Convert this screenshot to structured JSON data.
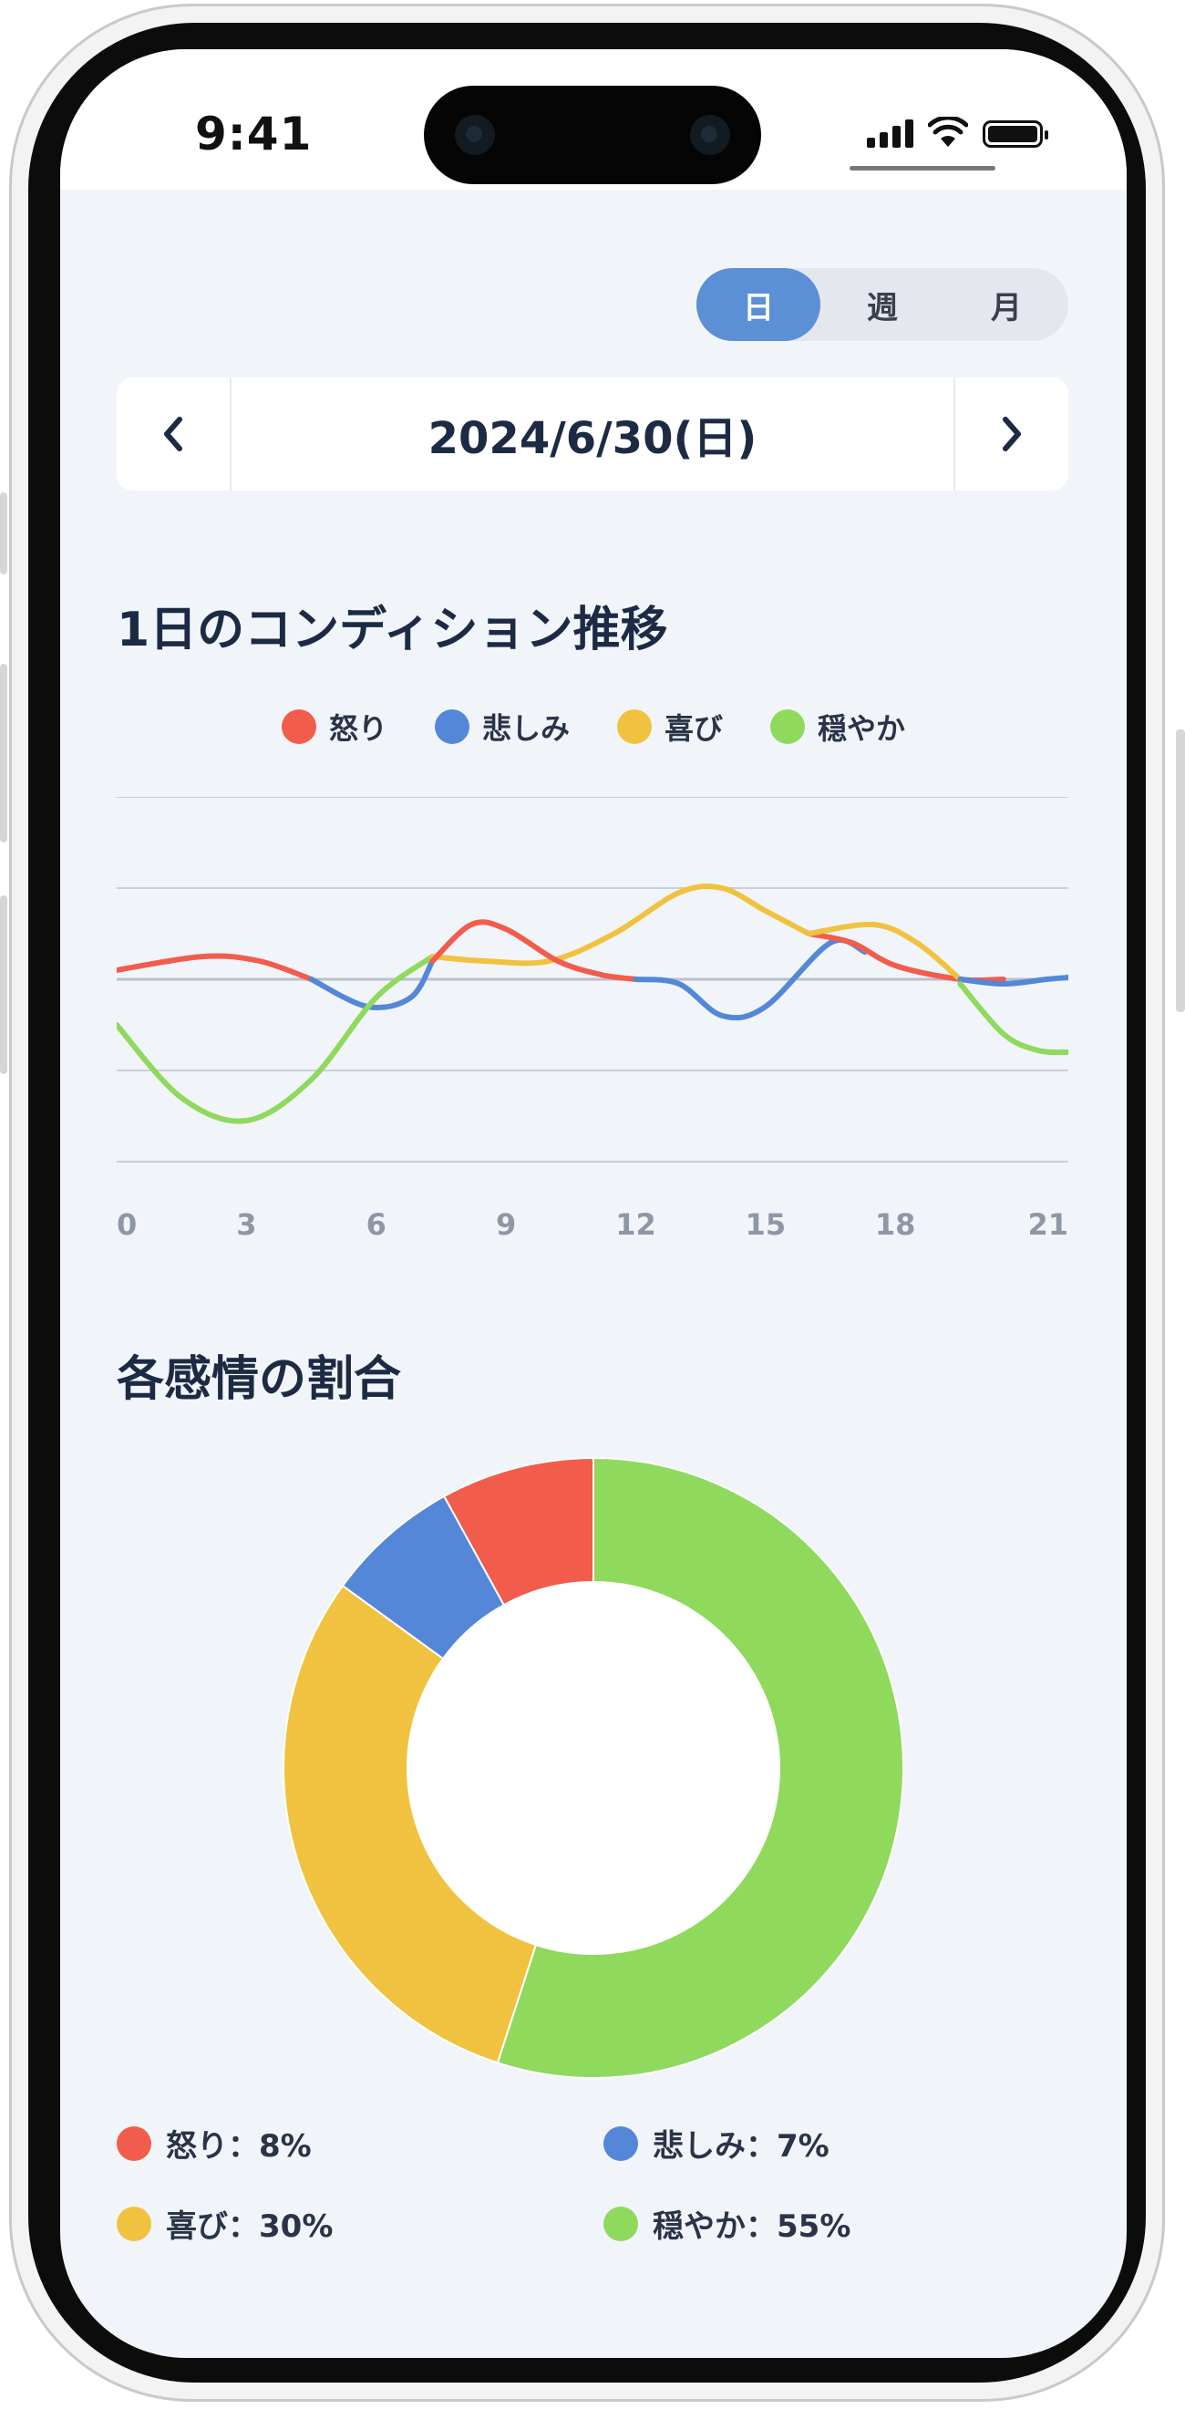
{
  "status_bar": {
    "time": "9:41"
  },
  "period_tabs": [
    {
      "label": "日",
      "active": true
    },
    {
      "label": "週",
      "active": false
    },
    {
      "label": "月",
      "active": false
    }
  ],
  "date_nav": {
    "prev_icon": "chevron-left-icon",
    "date": "2024/6/30(日)",
    "next_icon": "chevron-right-icon"
  },
  "colors": {
    "anger": "#f25c4d",
    "sadness": "#5487d8",
    "joy": "#f0c23f",
    "calm": "#8fd95c",
    "accent": "#5b8fd6"
  },
  "condition_section": {
    "title": "1日のコンディション推移"
  },
  "legend": [
    {
      "name": "怒り",
      "color": "#f25c4d"
    },
    {
      "name": "悲しみ",
      "color": "#5487d8"
    },
    {
      "name": "喜び",
      "color": "#f0c23f"
    },
    {
      "name": "穏やか",
      "color": "#8fd95c"
    }
  ],
  "ratio_section": {
    "title": "各感情の割合"
  },
  "ratio_legend": [
    {
      "label": "怒り：8%",
      "color": "#f25c4d"
    },
    {
      "label": "悲しみ：7%",
      "color": "#5487d8"
    },
    {
      "label": "喜び：30%",
      "color": "#f0c23f"
    },
    {
      "label": "穏やか：55%",
      "color": "#8fd95c"
    }
  ],
  "chart_data": [
    {
      "type": "line",
      "title": "1日のコンディション推移",
      "x_ticks": [
        "0",
        "3",
        "6",
        "9",
        "12",
        "15",
        "18",
        "21"
      ],
      "xlim": [
        0,
        22
      ],
      "ylim": [
        -2,
        2
      ],
      "grid": true,
      "legend": "top-center",
      "segments": [
        {
          "color": "#f25c4d",
          "points": [
            [
              0,
              0.1
            ],
            [
              2,
              0.25
            ],
            [
              3.3,
              0.2
            ],
            [
              4.5,
              0
            ]
          ]
        },
        {
          "color": "#5487d8",
          "points": [
            [
              4.5,
              0
            ],
            [
              5.8,
              -0.3
            ],
            [
              6.8,
              -0.2
            ],
            [
              7.3,
              0.2
            ]
          ]
        },
        {
          "color": "#8fd95c",
          "points": [
            [
              0,
              -0.5
            ],
            [
              1.5,
              -1.3
            ],
            [
              3,
              -1.55
            ],
            [
              4.5,
              -1.1
            ],
            [
              6,
              -0.2
            ],
            [
              7.3,
              0.25
            ]
          ]
        },
        {
          "color": "#f0c23f",
          "points": [
            [
              7.3,
              0.25
            ],
            [
              8.5,
              0.2
            ],
            [
              10,
              0.2
            ],
            [
              11.5,
              0.5
            ],
            [
              13,
              0.95
            ],
            [
              14,
              1.0
            ],
            [
              15,
              0.75
            ],
            [
              16,
              0.5
            ]
          ]
        },
        {
          "color": "#f25c4d",
          "points": [
            [
              7.3,
              0.2
            ],
            [
              8.2,
              0.6
            ],
            [
              9,
              0.55
            ],
            [
              10.2,
              0.2
            ],
            [
              11.2,
              0.05
            ],
            [
              12,
              0
            ]
          ]
        },
        {
          "color": "#5487d8",
          "points": [
            [
              12,
              0
            ],
            [
              13,
              -0.05
            ],
            [
              14,
              -0.4
            ],
            [
              15,
              -0.3
            ],
            [
              16.5,
              0.4
            ],
            [
              17.3,
              0.3
            ]
          ]
        },
        {
          "color": "#f25c4d",
          "points": [
            [
              16,
              0.5
            ],
            [
              17,
              0.4
            ],
            [
              18,
              0.15
            ],
            [
              19.5,
              0
            ],
            [
              20.5,
              0
            ]
          ]
        },
        {
          "color": "#f0c23f",
          "points": [
            [
              16,
              0.5
            ],
            [
              17.5,
              0.6
            ],
            [
              18.5,
              0.4
            ],
            [
              19.5,
              0
            ]
          ]
        },
        {
          "color": "#5487d8",
          "points": [
            [
              19.5,
              0
            ],
            [
              20.5,
              -0.05
            ],
            [
              21.5,
              0
            ],
            [
              22,
              0.02
            ]
          ]
        },
        {
          "color": "#8fd95c",
          "points": [
            [
              19.5,
              -0.05
            ],
            [
              20.5,
              -0.6
            ],
            [
              21.3,
              -0.78
            ],
            [
              22,
              -0.8
            ]
          ]
        }
      ]
    },
    {
      "type": "pie",
      "title": "各感情の割合",
      "categories": [
        "怒り",
        "悲しみ",
        "喜び",
        "穏やか"
      ],
      "values": [
        8,
        7,
        30,
        55
      ],
      "colors": [
        "#f25c4d",
        "#5487d8",
        "#f0c23f",
        "#8fd95c"
      ],
      "donut": true
    }
  ]
}
